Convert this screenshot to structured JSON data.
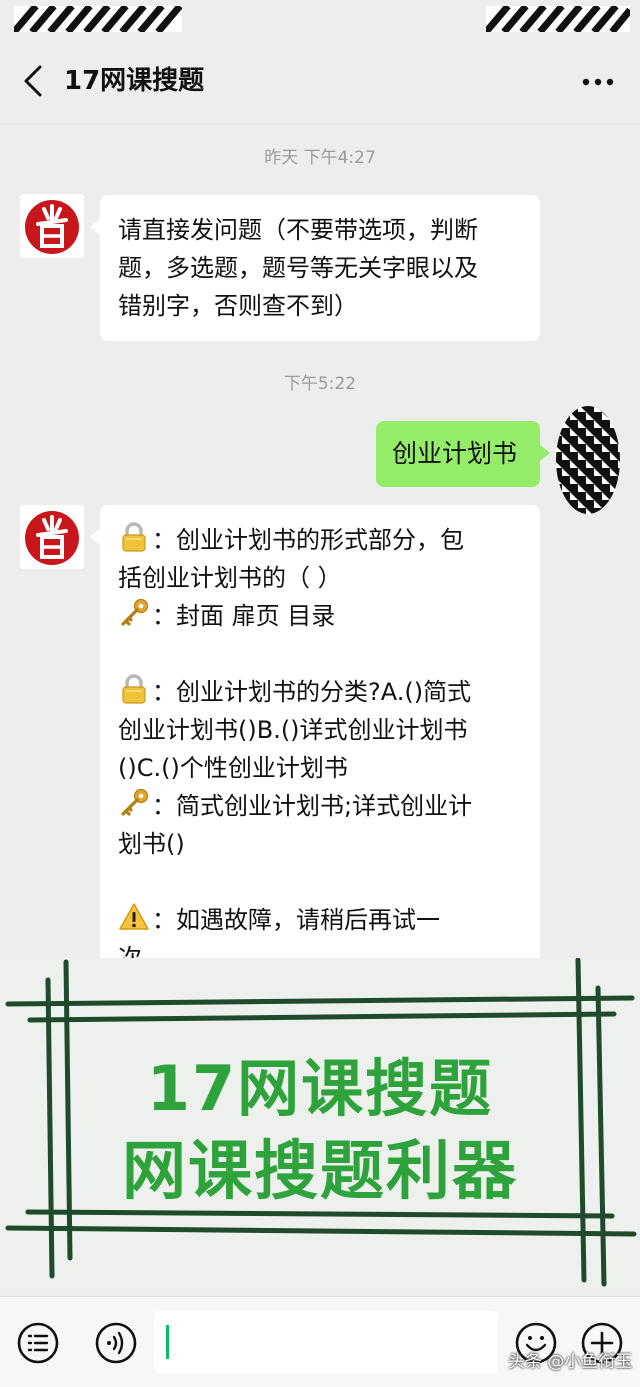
{
  "header": {
    "title": "17网课搜题"
  },
  "messages": {
    "time1": "昨天 下午4:27",
    "bot_intro": [
      "请直接发问题（不要带选项，判断",
      "题，多选题，题号等无关字眼以及",
      "错别字，否则查不到）"
    ],
    "time2": "下午5:22",
    "user_query": "创业计划书",
    "answer": {
      "q1": [
        "：创业计划书的形式部分，包",
        "括创业计划书的（ ）"
      ],
      "a1": [
        "：封面 扉页 目录"
      ],
      "q2": [
        "：创业计划书的分类?A.()简式",
        "创业计划书()B.()详式创业计划书",
        "()C.()个性创业计划书"
      ],
      "a2": [
        "：简式创业计划书;详式创业计",
        "划书()"
      ],
      "note": [
        "：如遇故障，请稍后再试一",
        "次。"
      ]
    }
  },
  "banner": {
    "line1": "17网课搜题",
    "line2": "网课搜题利器"
  },
  "input_bar": {
    "watermark": "头条 @小鱼衔玉"
  },
  "colors": {
    "user_bubble": "#95ec69",
    "banner_text": "#2fa33b",
    "banner_frame": "#1f4a2c",
    "avatar_red": "#c8161d"
  },
  "icons": [
    "back-arrow-icon",
    "more-icon",
    "lock-icon",
    "key-icon",
    "warning-icon",
    "list-icon",
    "voice-icon",
    "emoji-icon",
    "plus-icon"
  ]
}
